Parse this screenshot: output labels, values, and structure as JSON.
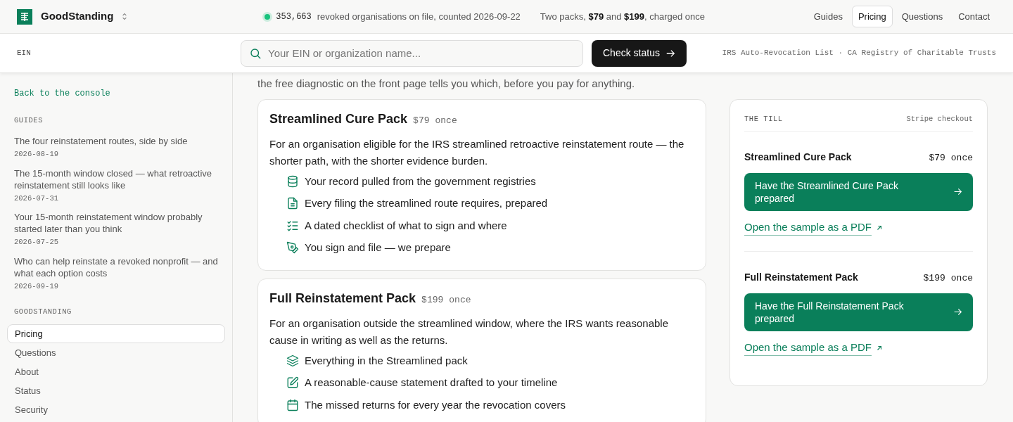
{
  "brand": {
    "name": "GoodStanding"
  },
  "status": {
    "count": "353,663",
    "text": "revoked organisations on file, counted 2026-09-22"
  },
  "offer": "Two packs, **$79** and **$199**, charged once",
  "nav": [
    {
      "label": "Guides",
      "selected": false
    },
    {
      "label": "Pricing",
      "selected": true
    },
    {
      "label": "Questions",
      "selected": false
    },
    {
      "label": "Contact",
      "selected": false
    }
  ],
  "search": {
    "label": "EIN",
    "placeholder": "Your EIN or organization name...",
    "button": "Check status",
    "sources": "IRS Auto-Revocation List · CA Registry of Charitable Trusts"
  },
  "sidebar": {
    "back": "Back to the console",
    "guides_heading": "GUIDES",
    "guides": [
      {
        "title": "The four reinstatement routes, side by side",
        "date": "2026-08-19"
      },
      {
        "title": "The 15-month window closed — what retroactive reinstatement still looks like",
        "date": "2026-07-31"
      },
      {
        "title": "Your 15-month reinstatement window probably started later than you think",
        "date": "2026-07-25"
      },
      {
        "title": "Who can help reinstate a revoked nonprofit — and what each option costs",
        "date": "2026-09-19"
      }
    ],
    "site_heading": "GOODSTANDING",
    "items": [
      {
        "label": "Pricing",
        "selected": true
      },
      {
        "label": "Questions",
        "selected": false
      },
      {
        "label": "About",
        "selected": false
      },
      {
        "label": "Status",
        "selected": false
      },
      {
        "label": "Security",
        "selected": false
      }
    ]
  },
  "intro": "the free diagnostic on the front page tells you which, before you pay for anything.",
  "packs": [
    {
      "name": "Streamlined Cure Pack",
      "price": "$79",
      "period": "once",
      "description": "For an organisation eligible for the IRS streamlined retroactive reinstatement route — the shorter path, with the shorter evidence burden.",
      "features": [
        "Your record pulled from the government registries",
        "Every filing the streamlined route requires, prepared",
        "A dated checklist of what to sign and where",
        "You sign and file — we prepare"
      ]
    },
    {
      "name": "Full Reinstatement Pack",
      "price": "$199",
      "period": "once",
      "description": "For an organisation outside the streamlined window, where the IRS wants reasonable cause in writing as well as the returns.",
      "features": [
        "Everything in the Streamlined pack",
        "A reasonable-cause statement drafted to your timeline",
        "The missed returns for every year the revocation covers"
      ]
    }
  ],
  "till": {
    "title": "THE TILL",
    "note": "Stripe checkout",
    "items": [
      {
        "name": "Streamlined Cure Pack",
        "price": "$79",
        "period": "once",
        "button": "Have the Streamlined Cure Pack prepared",
        "link": "Open the sample as a PDF"
      },
      {
        "name": "Full Reinstatement Pack",
        "price": "$199",
        "period": "once",
        "button": "Have the Full Reinstatement Pack prepared",
        "link": "Open the sample as a PDF"
      }
    ]
  }
}
